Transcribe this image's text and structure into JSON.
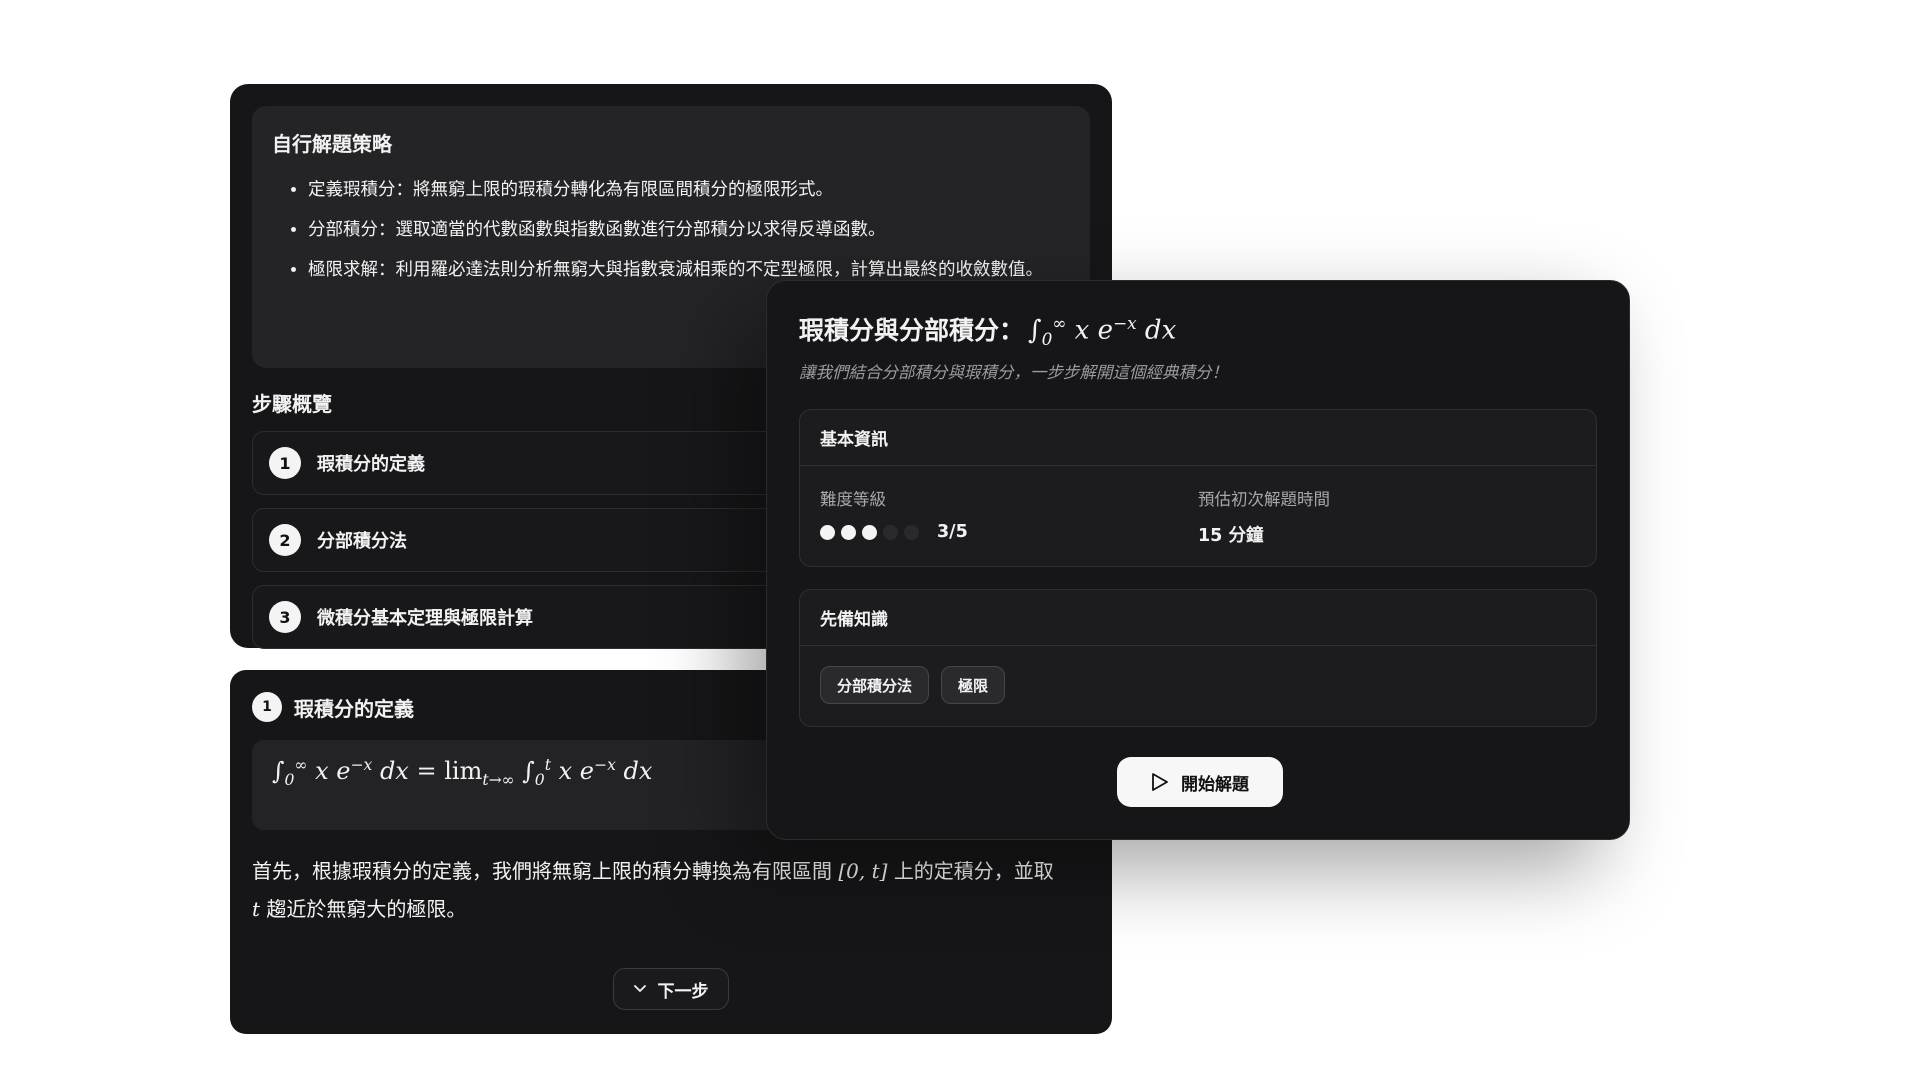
{
  "strategy": {
    "title": "自行解題策略",
    "items": [
      "定義瑕積分：將無窮上限的瑕積分轉化為有限區間積分的極限形式。",
      "分部積分：選取適當的代數函數與指數函數進行分部積分以求得反導函數。",
      "極限求解：利用羅必達法則分析無窮大與指數衰減相乘的不定型極限，計算出最終的收斂數值。"
    ]
  },
  "overview": {
    "title": "步驟概覽",
    "steps": [
      {
        "num": "1",
        "label": "瑕積分的定義"
      },
      {
        "num": "2",
        "label": "分部積分法"
      },
      {
        "num": "3",
        "label": "微積分基本定理與極限計算"
      }
    ]
  },
  "detail": {
    "num": "1",
    "title": "瑕積分的定義",
    "text_a": "首先，根據瑕積分的定義，我們將無窮上限的積分轉換為有限區間",
    "text_interval": "[0, t]",
    "text_b": "上的定積分，並取",
    "text_var": "t",
    "text_c": "趨近於無窮大的極限。",
    "next_label": "下一步"
  },
  "problem": {
    "title": "瑕積分與分部積分：",
    "subtitle": "讓我們結合分部積分與瑕積分，一步步解開這個經典積分！",
    "basic_info": {
      "header": "基本資訊",
      "difficulty_label": "難度等級",
      "difficulty_value": 3,
      "difficulty_max": 5,
      "difficulty_text": "3/5",
      "time_label": "預估初次解題時間",
      "time_value": "15 分鐘"
    },
    "prereq": {
      "header": "先備知識",
      "tags": [
        "分部積分法",
        "極限"
      ]
    },
    "start_label": "開始解題"
  },
  "colors": {
    "card_bg": "#161618",
    "accent_white": "#f4f4f4",
    "muted": "#9a9aa0"
  }
}
